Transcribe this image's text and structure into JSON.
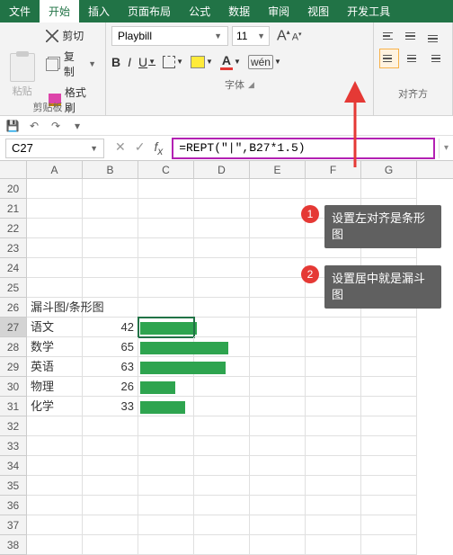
{
  "tabs": [
    "文件",
    "开始",
    "插入",
    "页面布局",
    "公式",
    "数据",
    "审阅",
    "视图",
    "开发工具"
  ],
  "active_tab": 1,
  "clipboard": {
    "paste": "粘贴",
    "cut": "剪切",
    "copy": "复制",
    "brush": "格式刷",
    "group_label": "剪贴板"
  },
  "font": {
    "name": "Playbill",
    "size": "11",
    "group_label": "字体"
  },
  "align": {
    "group_label": "对齐方"
  },
  "namebox": "C27",
  "formula": "=REPT(\"|\",B27*1.5)",
  "columns": [
    "A",
    "B",
    "C",
    "D",
    "E",
    "F",
    "G"
  ],
  "first_row": 20,
  "last_row": 38,
  "data_title_row": 26,
  "data_title": "漏斗图/条形图",
  "active_cell": {
    "row": 27,
    "col": 2
  },
  "chart_data": {
    "type": "bar",
    "title": "漏斗图/条形图",
    "categories": [
      "语文",
      "数学",
      "英语",
      "物理",
      "化学"
    ],
    "values": [
      42,
      65,
      63,
      26,
      33
    ],
    "formula": "=REPT(\"|\",B27*1.5)",
    "xlabel": "",
    "ylabel": "",
    "ylim": [
      0,
      100
    ]
  },
  "callouts": [
    {
      "n": "1",
      "text": "设置左对齐是条形图"
    },
    {
      "n": "2",
      "text": "设置居中就是漏斗图"
    }
  ]
}
